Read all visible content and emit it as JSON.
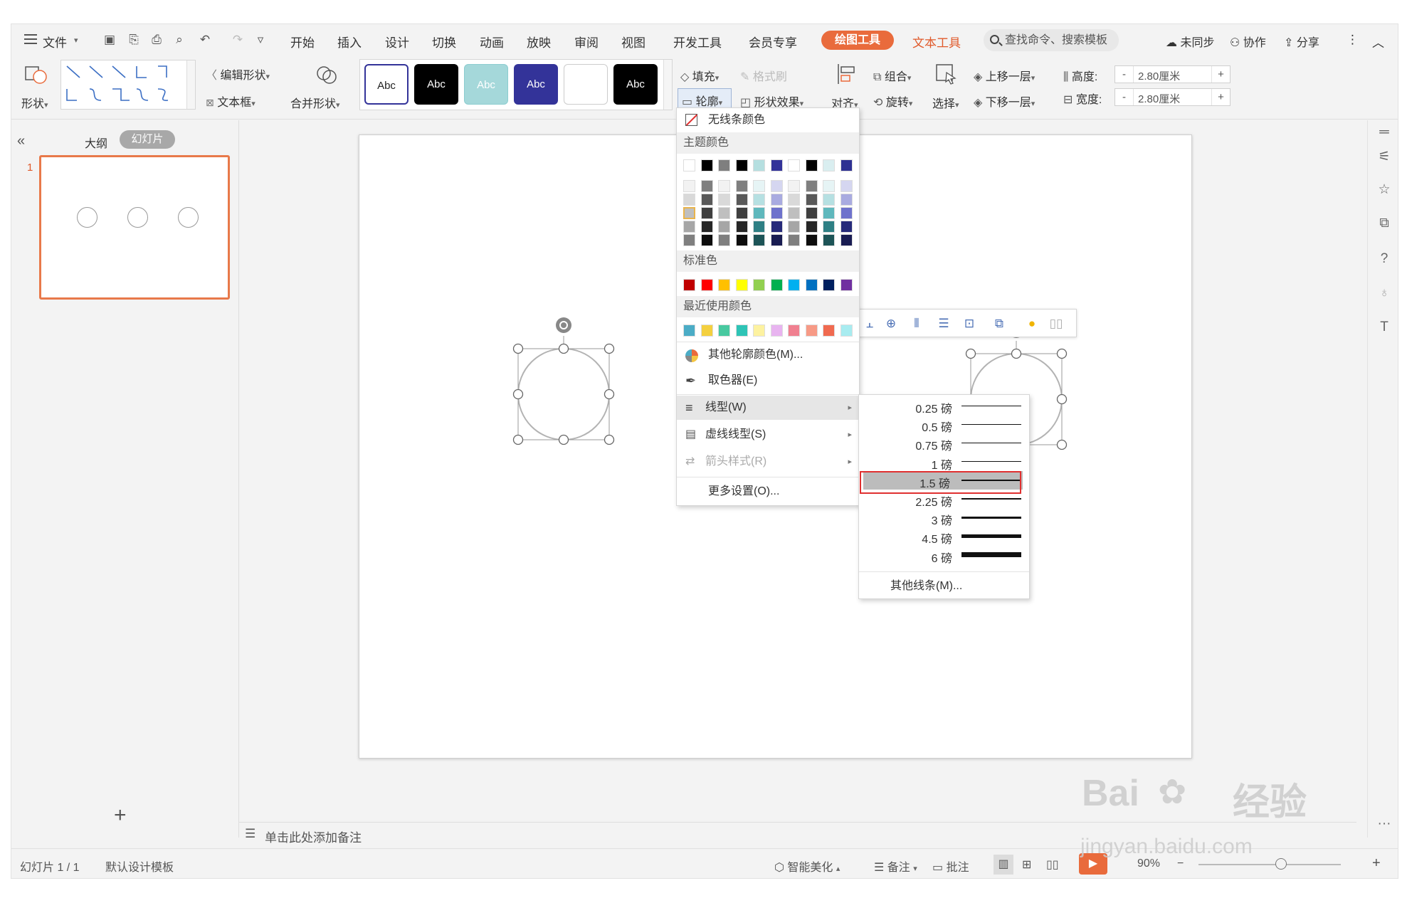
{
  "menubar": {
    "file": "文件",
    "tabs": [
      "开始",
      "插入",
      "设计",
      "切换",
      "动画",
      "放映",
      "审阅",
      "视图",
      "开发工具",
      "会员专享"
    ],
    "active_tab": "绘图工具",
    "text_tool_tab": "文本工具",
    "search_placeholder": "查找命令、搜索模板",
    "sync": "未同步",
    "collab": "协作",
    "share": "分享"
  },
  "ribbon": {
    "shape": "形状",
    "edit_shape": "编辑形状",
    "text_box": "文本框",
    "merge_shape": "合并形状",
    "style_abc": "Abc",
    "fill": "填充",
    "format_painter": "格式刷",
    "outline": "轮廓",
    "shape_effect": "形状效果",
    "align": "对齐",
    "group": "组合",
    "rotate": "旋转",
    "select": "选择",
    "bring_forward": "上移一层",
    "send_backward": "下移一层",
    "height_label": "高度:",
    "height_value": "2.80厘米",
    "width_label": "宽度:",
    "width_value": "2.80厘米",
    "minus": "-",
    "plus": "+"
  },
  "left_panel": {
    "outline_tab": "大纲",
    "slides_tab": "幻灯片",
    "slide_number": "1"
  },
  "notes_placeholder": "单击此处添加备注",
  "statusbar": {
    "slide_info": "幻灯片 1 / 1",
    "template": "默认设计模板",
    "beautify": "智能美化",
    "notes": "备注",
    "comments": "批注",
    "zoom": "90%"
  },
  "outline_menu": {
    "no_line": "无线条颜色",
    "theme_colors": "主题颜色",
    "standard_colors": "标准色",
    "recent_colors": "最近使用颜色",
    "more_colors": "其他轮廓颜色(M)...",
    "eyedropper": "取色器(E)",
    "line_type": "线型(W)",
    "dash_type": "虚线线型(S)",
    "arrow_style": "箭头样式(R)",
    "more_settings": "更多设置(O)...",
    "theme_top": [
      "#ffffff",
      "#000000",
      "#7f7f7f",
      "#000000",
      "#b5dfe0",
      "#333399",
      "#ffffff",
      "#000000",
      "#d9eef0",
      "#2e3192"
    ],
    "theme_shades": [
      [
        "#f2f2f2",
        "#7f7f7f",
        "#f2f2f2",
        "#7f7f7f",
        "#e6f4f5",
        "#d5d6f0",
        "#f2f2f2",
        "#7f7f7f",
        "#e6f4f5",
        "#d5d6f0"
      ],
      [
        "#d9d9d9",
        "#595959",
        "#d9d9d9",
        "#595959",
        "#b6e0e2",
        "#a9abe0",
        "#d9d9d9",
        "#595959",
        "#b6e0e2",
        "#a9abe0"
      ],
      [
        "#bfbfbf",
        "#3f3f3f",
        "#bfbfbf",
        "#3f3f3f",
        "#5fb8bd",
        "#6e72cc",
        "#bfbfbf",
        "#3f3f3f",
        "#5fb8bd",
        "#6e72cc"
      ],
      [
        "#a6a6a6",
        "#262626",
        "#a6a6a6",
        "#262626",
        "#2e7f84",
        "#262a7a",
        "#a6a6a6",
        "#262626",
        "#2e7f84",
        "#262a7a"
      ],
      [
        "#7f7f7f",
        "#0d0d0d",
        "#7f7f7f",
        "#0d0d0d",
        "#1d5457",
        "#191c52",
        "#7f7f7f",
        "#0d0d0d",
        "#1d5457",
        "#191c52"
      ]
    ],
    "standard": [
      "#c00000",
      "#ff0000",
      "#ffc000",
      "#ffff00",
      "#92d050",
      "#00b050",
      "#00b0f0",
      "#0070c0",
      "#002060",
      "#7030a0"
    ],
    "recent": [
      "#4bacc6",
      "#f4d03f",
      "#48c9a0",
      "#2ec4b6",
      "#fdf2a0",
      "#e8b4f0",
      "#f08090",
      "#f79a86",
      "#f06a50",
      "#a8ecf0"
    ]
  },
  "line_weights": [
    {
      "label": "0.25 磅",
      "weight": 0.25
    },
    {
      "label": "0.5 磅",
      "weight": 0.5
    },
    {
      "label": "0.75 磅",
      "weight": 0.75
    },
    {
      "label": "1 磅",
      "weight": 1
    },
    {
      "label": "1.5 磅",
      "weight": 1.5,
      "selected": true
    },
    {
      "label": "2.25 磅",
      "weight": 2.25
    },
    {
      "label": "3 磅",
      "weight": 3
    },
    {
      "label": "4.5 磅",
      "weight": 4.5
    },
    {
      "label": "6 磅",
      "weight": 6
    }
  ],
  "other_lines": "其他线条(M)...",
  "watermark": {
    "brand": "Bai",
    "cn": "经验",
    "url": "jingyan.baidu.com"
  },
  "colors": {
    "accent": "#e96b3c",
    "selection": "#e03030"
  }
}
